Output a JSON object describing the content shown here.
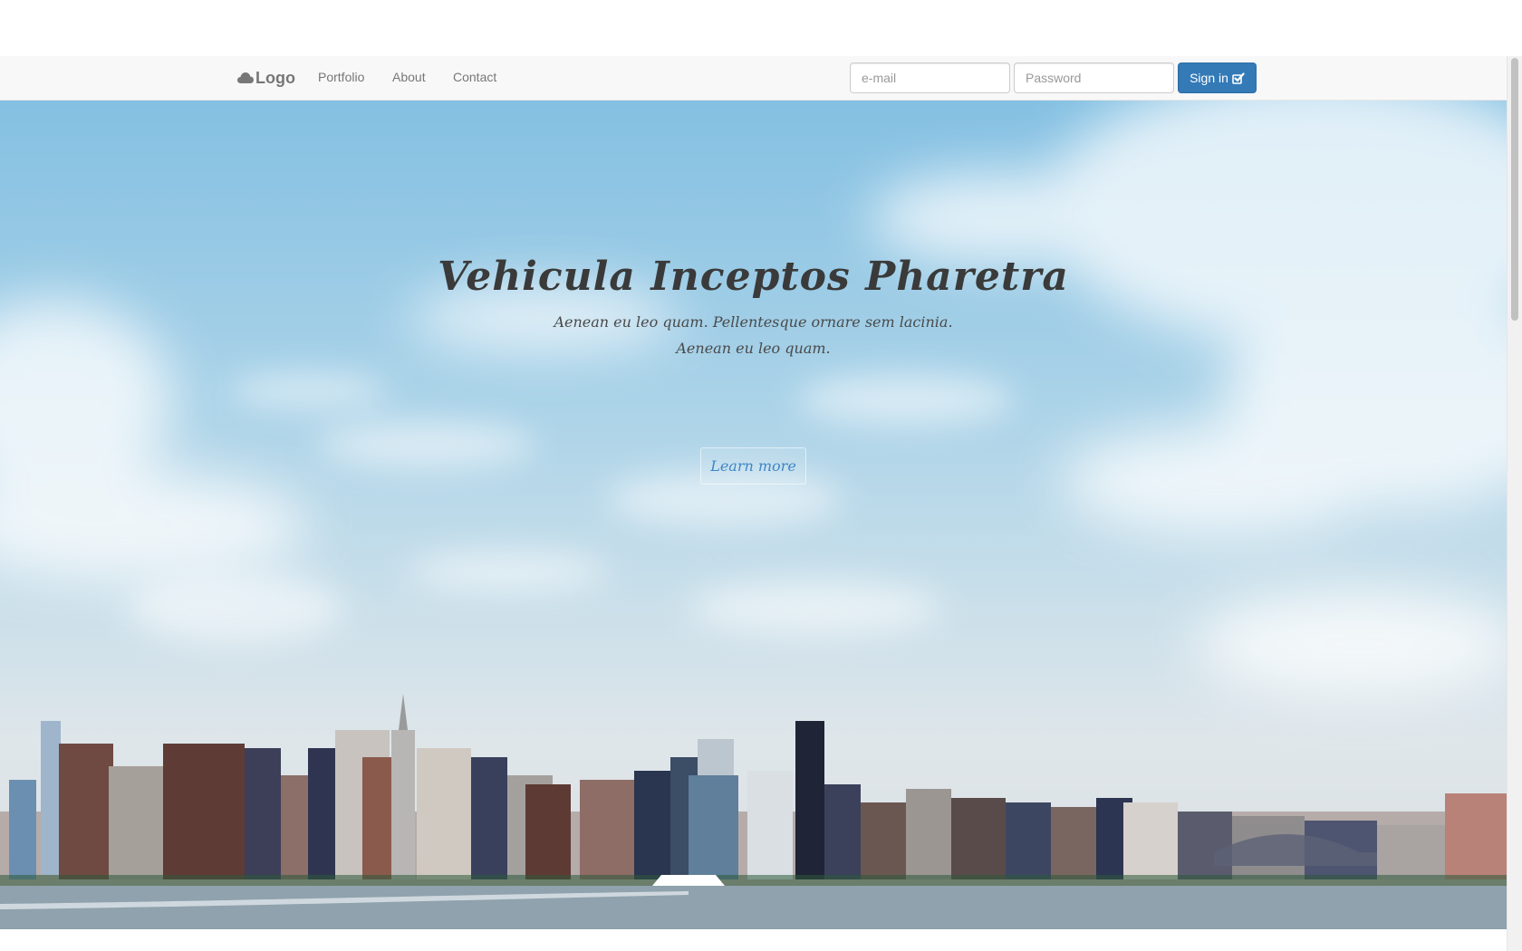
{
  "navbar": {
    "brand": "Logo",
    "brand_icon": "cloud-icon",
    "links": [
      "Portfolio",
      "About",
      "Contact"
    ],
    "email_placeholder": "e-mail",
    "password_placeholder": "Password",
    "signin_label": "Sign in",
    "signin_icon": "check-square-icon"
  },
  "hero": {
    "title": "Vehicula Inceptos Pharetra",
    "subtitle_line1": "Aenean eu leo quam. Pellentesque ornare sem lacinia.",
    "subtitle_line2": "Aenean eu leo quam.",
    "button_label": "Learn more"
  },
  "colors": {
    "primary": "#337ab7",
    "navbar_bg": "#f8f8f8",
    "nav_text": "#777777",
    "link_accent": "#3f86c6"
  }
}
